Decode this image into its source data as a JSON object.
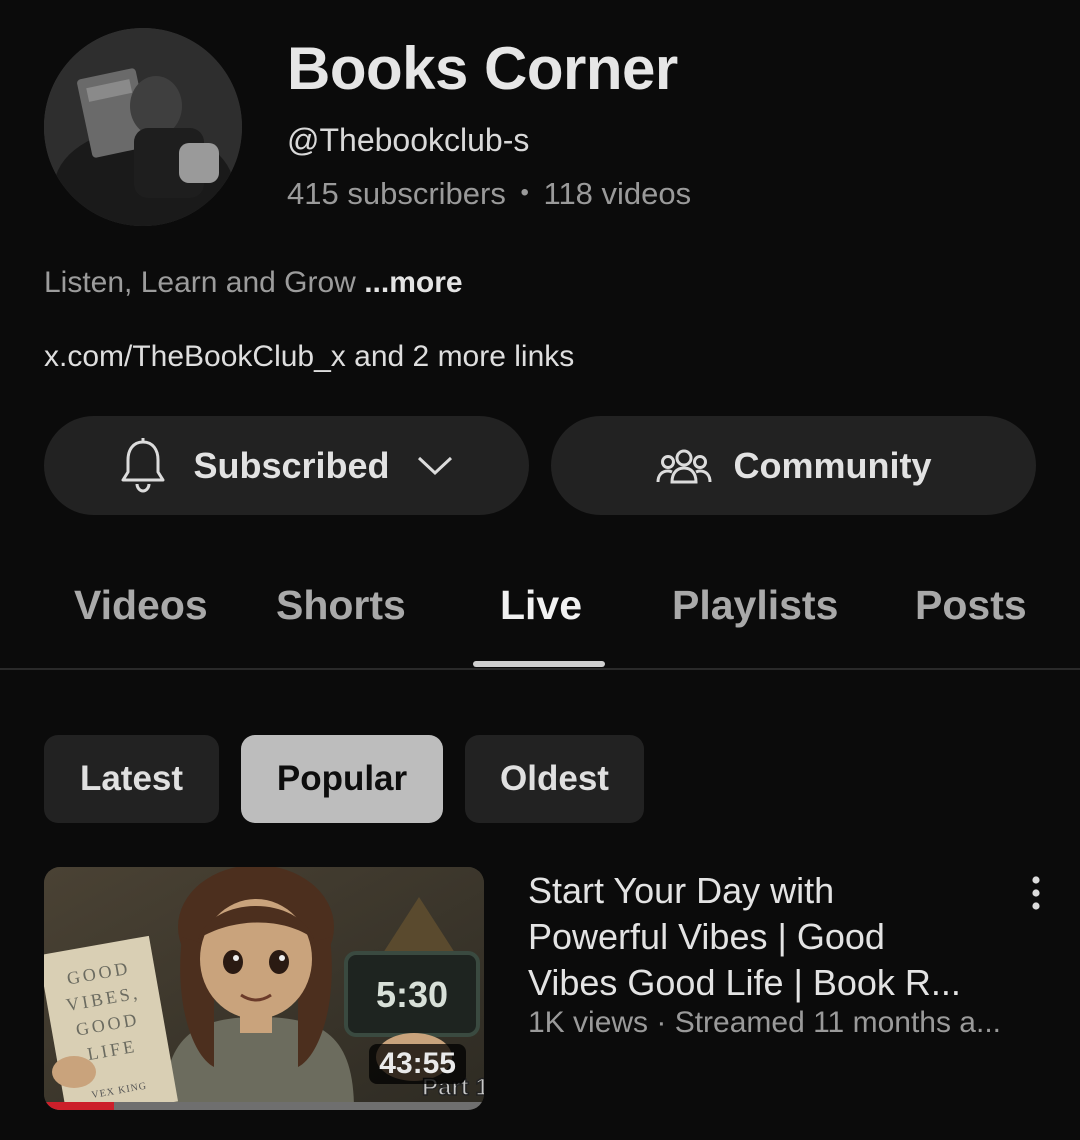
{
  "channel": {
    "name": "Books Corner",
    "handle": "@Thebookclub-s",
    "subscribers": "415 subscribers",
    "separator": "•",
    "videos": "118 videos",
    "description": "Listen, Learn and Grow",
    "description_more": "...more",
    "link_primary": "x.com/TheBookClub_x",
    "link_extra": "and 2 more links"
  },
  "actions": {
    "subscribed_label": "Subscribed",
    "community_label": "Community"
  },
  "tabs": [
    {
      "label": "Videos"
    },
    {
      "label": "Shorts"
    },
    {
      "label": "Live",
      "active": true
    },
    {
      "label": "Playlists"
    },
    {
      "label": "Posts"
    }
  ],
  "filters": [
    {
      "label": "Latest"
    },
    {
      "label": "Popular",
      "selected": true
    },
    {
      "label": "Oldest"
    }
  ],
  "video": {
    "title_lines": [
      "Start Your Day with",
      "Powerful Vibes | Good",
      "Vibes Good Life | Book R..."
    ],
    "meta": "1K views · Streamed 11 months a...",
    "duration": "43:55",
    "progress_fraction": 0.16,
    "thumbnail": {
      "clock_text": "5:30",
      "book_title": [
        "GOOD",
        "VIBES,",
        "GOOD",
        "LIFE"
      ],
      "book_author": "VEX KING",
      "part_text": "Part 1"
    }
  },
  "icons": {
    "bell": "bell-icon",
    "chevron": "chevron-down-icon",
    "community": "people-icon",
    "more": "more-vert-icon"
  },
  "colors": {
    "background": "#0b0b0b",
    "pill": "#222222",
    "selected_chip": "#bdbdbd",
    "progress": "#cc1f2a"
  }
}
